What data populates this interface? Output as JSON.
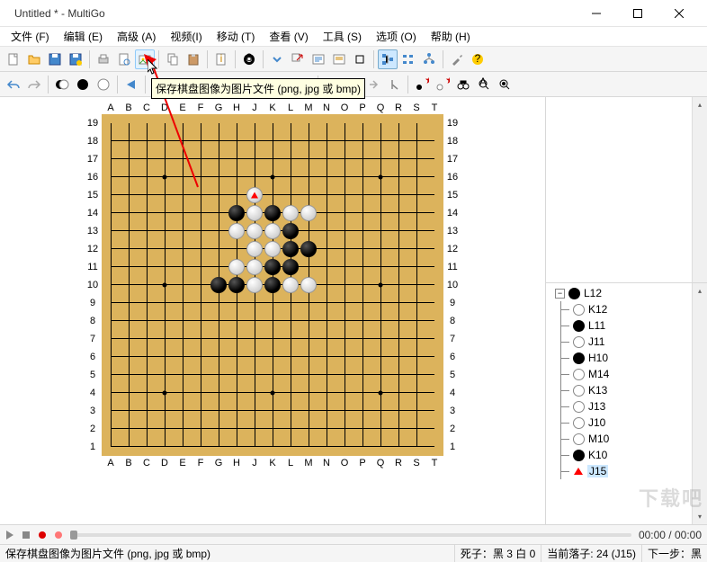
{
  "window": {
    "title": "Untitled  * - MultiGo"
  },
  "menu": {
    "file": "文件 (F)",
    "edit": "编辑 (E)",
    "advanced": "高级 (A)",
    "video": "视频(I)",
    "move": "移动 (T)",
    "view": "查看 (V)",
    "tools": "工具 (S)",
    "options": "选项 (O)",
    "help": "帮助 (H)"
  },
  "tooltip": {
    "save_image": "保存棋盘图像为图片文件 (png, jpg 或 bmp)"
  },
  "board": {
    "size": 19,
    "columns": [
      "A",
      "B",
      "C",
      "D",
      "E",
      "F",
      "G",
      "H",
      "J",
      "K",
      "L",
      "M",
      "N",
      "O",
      "P",
      "Q",
      "R",
      "S",
      "T"
    ],
    "rows": [
      19,
      18,
      17,
      16,
      15,
      14,
      13,
      12,
      11,
      10,
      9,
      8,
      7,
      6,
      5,
      4,
      3,
      2,
      1
    ],
    "star_points": [
      [
        4,
        4
      ],
      [
        4,
        10
      ],
      [
        4,
        16
      ],
      [
        10,
        4
      ],
      [
        10,
        10
      ],
      [
        10,
        16
      ],
      [
        16,
        4
      ],
      [
        16,
        10
      ],
      [
        16,
        16
      ]
    ],
    "stones": [
      {
        "coord": "J15",
        "color": "white",
        "col": 9,
        "row": 15,
        "marked": true
      },
      {
        "coord": "H14",
        "color": "black",
        "col": 8,
        "row": 14
      },
      {
        "coord": "J14",
        "color": "white",
        "col": 9,
        "row": 14
      },
      {
        "coord": "K14",
        "color": "black",
        "col": 10,
        "row": 14
      },
      {
        "coord": "L14",
        "color": "white",
        "col": 11,
        "row": 14
      },
      {
        "coord": "M14",
        "color": "white",
        "col": 12,
        "row": 14
      },
      {
        "coord": "H13",
        "color": "white",
        "col": 8,
        "row": 13
      },
      {
        "coord": "J13",
        "color": "white",
        "col": 9,
        "row": 13
      },
      {
        "coord": "K13",
        "color": "white",
        "col": 10,
        "row": 13
      },
      {
        "coord": "L13",
        "color": "black",
        "col": 11,
        "row": 13
      },
      {
        "coord": "J12",
        "color": "white",
        "col": 9,
        "row": 12
      },
      {
        "coord": "K12",
        "color": "white",
        "col": 10,
        "row": 12
      },
      {
        "coord": "L12",
        "color": "black",
        "col": 11,
        "row": 12
      },
      {
        "coord": "M12",
        "color": "black",
        "col": 12,
        "row": 12
      },
      {
        "coord": "H11",
        "color": "white",
        "col": 8,
        "row": 11
      },
      {
        "coord": "J11",
        "color": "white",
        "col": 9,
        "row": 11
      },
      {
        "coord": "K11",
        "color": "black",
        "col": 10,
        "row": 11
      },
      {
        "coord": "L11",
        "color": "black",
        "col": 11,
        "row": 11
      },
      {
        "coord": "G10",
        "color": "black",
        "col": 7,
        "row": 10
      },
      {
        "coord": "H10",
        "color": "black",
        "col": 8,
        "row": 10
      },
      {
        "coord": "J10",
        "color": "white",
        "col": 9,
        "row": 10
      },
      {
        "coord": "K10",
        "color": "black",
        "col": 10,
        "row": 10
      },
      {
        "coord": "L10",
        "color": "white",
        "col": 11,
        "row": 10
      },
      {
        "coord": "M10",
        "color": "white",
        "col": 12,
        "row": 10
      }
    ]
  },
  "move_tree": {
    "items": [
      {
        "color": "black",
        "label": "L12"
      },
      {
        "color": "white",
        "label": "K12"
      },
      {
        "color": "black",
        "label": "L11"
      },
      {
        "color": "white",
        "label": "J11"
      },
      {
        "color": "black",
        "label": "H10"
      },
      {
        "color": "white",
        "label": "M14"
      },
      {
        "color": "white",
        "label": "K13"
      },
      {
        "color": "white",
        "label": "J13"
      },
      {
        "color": "white",
        "label": "J10"
      },
      {
        "color": "white",
        "label": "M10"
      },
      {
        "color": "black",
        "label": "K10"
      },
      {
        "color": "tri",
        "label": "J15",
        "selected": true
      }
    ]
  },
  "playback": {
    "time": "00:00 / 00:00"
  },
  "status": {
    "hint": "保存棋盘图像为图片文件 (png, jpg 或 bmp)",
    "captures": "死子：黑 3 白 0",
    "current": "当前落子: 24 (J15)",
    "next": "下一步：黑"
  },
  "watermark": "下载吧"
}
